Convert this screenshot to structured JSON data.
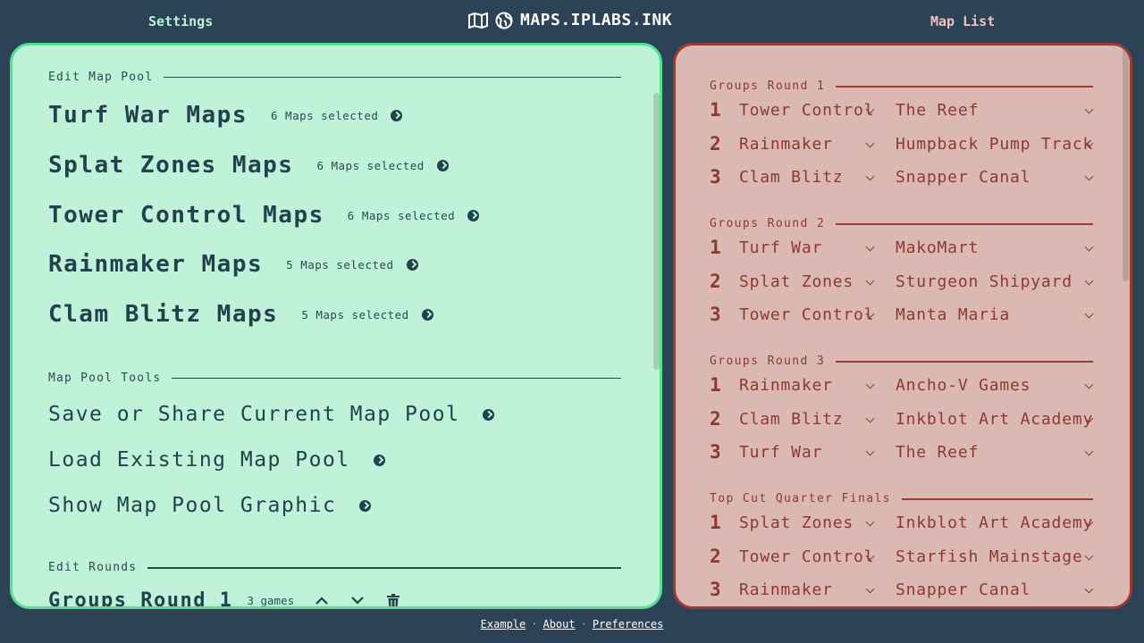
{
  "header": {
    "settings_tab": "Settings",
    "brand_title": "MAPS.IPLABS.INK",
    "map_list_tab": "Map List"
  },
  "settings": {
    "map_pool_heading": "Edit Map Pool",
    "modes": [
      {
        "name": "Turf War Maps",
        "count": "6 Maps selected"
      },
      {
        "name": "Splat Zones Maps",
        "count": "6 Maps selected"
      },
      {
        "name": "Tower Control Maps",
        "count": "6 Maps selected"
      },
      {
        "name": "Rainmaker Maps",
        "count": "5 Maps selected"
      },
      {
        "name": "Clam Blitz Maps",
        "count": "5 Maps selected"
      }
    ],
    "tools_heading": "Map Pool Tools",
    "tools": [
      "Save or Share Current Map Pool",
      "Load Existing Map Pool",
      "Show Map Pool Graphic"
    ],
    "rounds_heading": "Edit Rounds",
    "round": {
      "name": "Groups Round 1",
      "games": "3 games"
    }
  },
  "map_list": {
    "rounds": [
      {
        "title": "Groups Round 1",
        "games": [
          {
            "num": "1",
            "mode": "Tower Control",
            "map": "The Reef"
          },
          {
            "num": "2",
            "mode": "Rainmaker",
            "map": "Humpback Pump Track"
          },
          {
            "num": "3",
            "mode": "Clam Blitz",
            "map": "Snapper Canal"
          }
        ]
      },
      {
        "title": "Groups Round 2",
        "games": [
          {
            "num": "1",
            "mode": "Turf War",
            "map": "MakoMart"
          },
          {
            "num": "2",
            "mode": "Splat Zones",
            "map": "Sturgeon Shipyard"
          },
          {
            "num": "3",
            "mode": "Tower Control",
            "map": "Manta Maria"
          }
        ]
      },
      {
        "title": "Groups Round 3",
        "games": [
          {
            "num": "1",
            "mode": "Rainmaker",
            "map": "Ancho-V Games"
          },
          {
            "num": "2",
            "mode": "Clam Blitz",
            "map": "Inkblot Art Academy"
          },
          {
            "num": "3",
            "mode": "Turf War",
            "map": "The Reef"
          }
        ]
      },
      {
        "title": "Top Cut Quarter Finals",
        "games": [
          {
            "num": "1",
            "mode": "Splat Zones",
            "map": "Inkblot Art Academy"
          },
          {
            "num": "2",
            "mode": "Tower Control",
            "map": "Starfish Mainstage"
          },
          {
            "num": "3",
            "mode": "Rainmaker",
            "map": "Snapper Canal"
          }
        ]
      }
    ]
  },
  "footer": {
    "example": "Example",
    "about": "About",
    "preferences": "Preferences",
    "separator": "·"
  },
  "colors": {
    "background": "#2b4257",
    "settings_panel": "#c0f2da",
    "settings_border": "#4fe291",
    "maplist_panel": "#dcb8b3",
    "maplist_border": "#9c3b32",
    "text_dark": "#22414d",
    "text_red": "#8c3a30"
  },
  "icons": [
    "map-icon",
    "globe-icon",
    "chevron-right-icon",
    "chevron-up-icon",
    "chevron-down-icon",
    "trash-icon"
  ]
}
